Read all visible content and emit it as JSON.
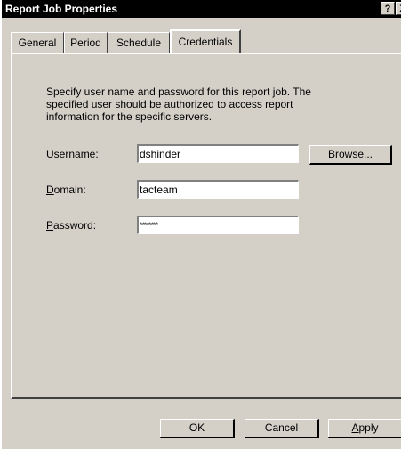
{
  "window": {
    "title": "Report Job Properties",
    "help_glyph": "?",
    "close_glyph": "X"
  },
  "tabs": [
    {
      "label": "General"
    },
    {
      "label": "Period"
    },
    {
      "label": "Schedule"
    },
    {
      "label": "Credentials",
      "active": true
    }
  ],
  "credentials": {
    "description": "Specify user name and password for this report job. The specified user should be authorized to access report information for the specific servers.",
    "username": {
      "label_prefix": "",
      "label_accel": "U",
      "label_rest": "sername:",
      "value": "dshinder"
    },
    "domain": {
      "label_prefix": "",
      "label_accel": "D",
      "label_rest": "omain:",
      "value": "tacteam"
    },
    "password": {
      "label_prefix": "",
      "label_accel": "P",
      "label_rest": "assword:",
      "value": "********"
    },
    "browse": {
      "label_prefix": "",
      "label_accel": "B",
      "label_rest": "rowse..."
    }
  },
  "buttons": {
    "ok": "OK",
    "cancel": "Cancel",
    "apply": {
      "label_prefix": "",
      "label_accel": "A",
      "label_rest": "pply"
    }
  }
}
